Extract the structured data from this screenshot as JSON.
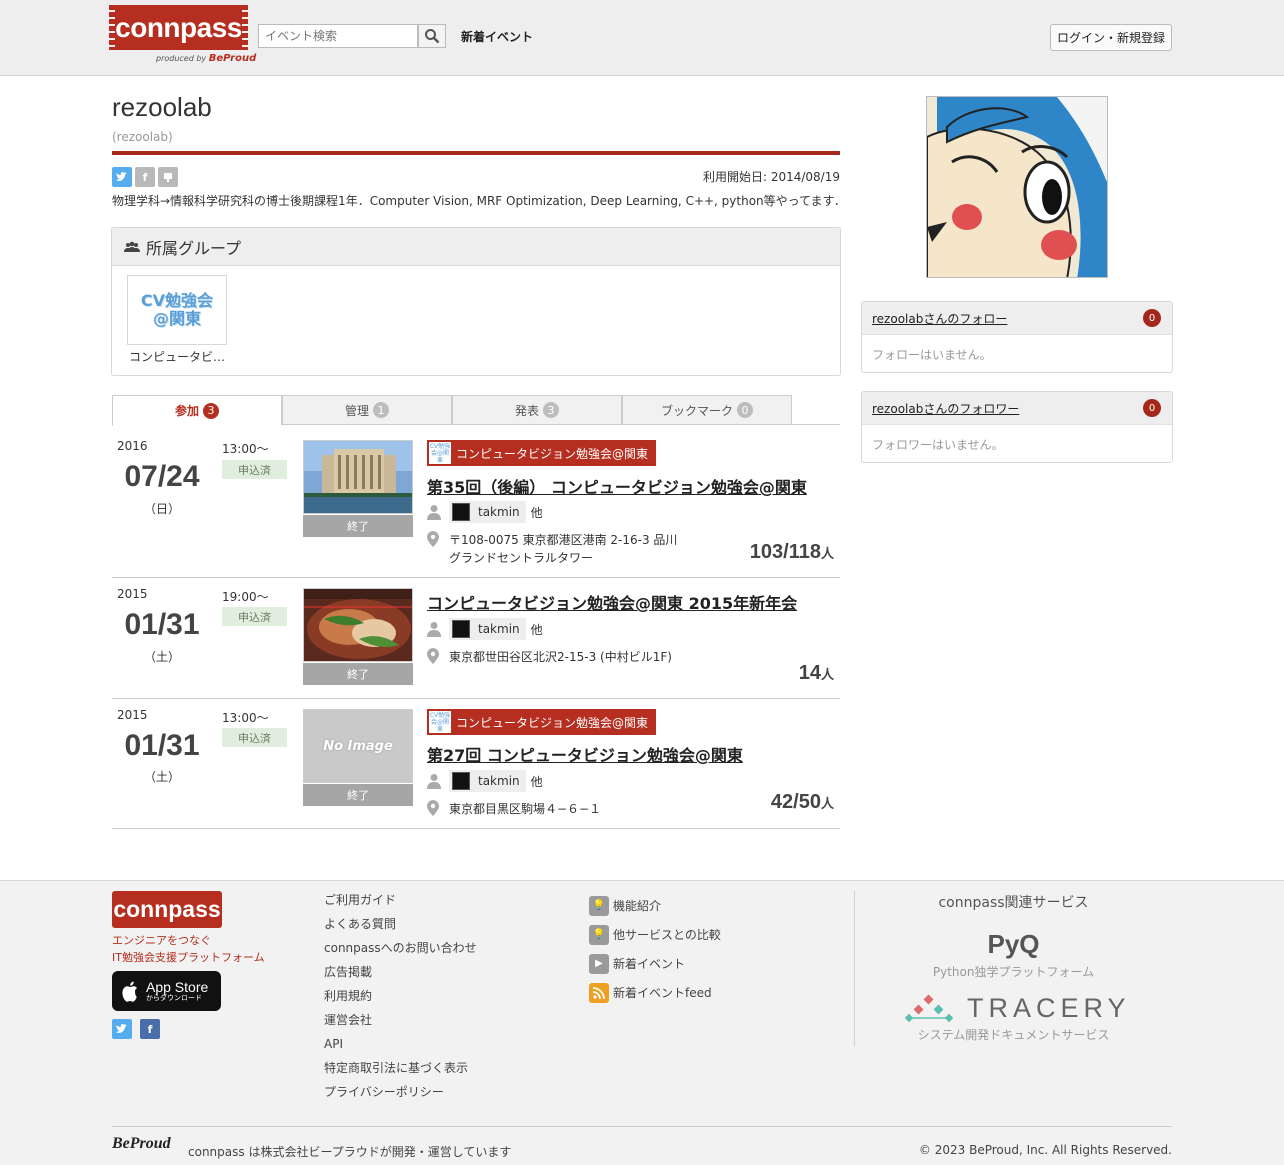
{
  "header": {
    "logo": "connpass",
    "logo_sub": "produced by",
    "logo_sub_brand": "BeProud",
    "search_placeholder": "イベント検索",
    "nav_new_events": "新着イベント",
    "login_label": "ログイン・新規登録"
  },
  "profile": {
    "display_name": "rezoolab",
    "username": "(rezoolab)",
    "since": "利用開始日: 2014/08/19",
    "bio": "物理学科→情報科学研究科の博士後期課程1年．Computer Vision, MRF Optimization, Deep Learning, C++, python等やってます．"
  },
  "groups": {
    "title": "所属グループ",
    "items": [
      {
        "thumb_text": "CV勉強会\n@関東",
        "name": "コンピュータビジョン勉強会@関東"
      }
    ]
  },
  "tabs": [
    {
      "label": "参加",
      "count": "3",
      "active": true
    },
    {
      "label": "管理",
      "count": "1",
      "active": false
    },
    {
      "label": "発表",
      "count": "3",
      "active": false
    },
    {
      "label": "ブックマーク",
      "count": "0",
      "active": false
    }
  ],
  "events": [
    {
      "year": "2016",
      "date": "07/24",
      "dow": "（日）",
      "time": "13:00〜",
      "status": "申込済",
      "ended": "終了",
      "group": "コンピュータビジョン勉強会@関東",
      "title": "第35回（後編） コンピュータビジョン勉強会@関東",
      "owner": "takmin",
      "owner_suffix": "他",
      "place": "〒108-0075 東京都港区港南 2-16-3 品川グランドセントラルタワー",
      "count": "103/118",
      "unit": "人"
    },
    {
      "year": "2015",
      "date": "01/31",
      "dow": "（土）",
      "time": "19:00〜",
      "status": "申込済",
      "ended": "終了",
      "group": "",
      "title": "コンピュータビジョン勉強会@関東 2015年新年会",
      "owner": "takmin",
      "owner_suffix": "他",
      "place": "東京都世田谷区北沢2-15-3 (中村ビル1F)",
      "count": "14",
      "unit": "人"
    },
    {
      "year": "2015",
      "date": "01/31",
      "dow": "（土）",
      "time": "13:00〜",
      "status": "申込済",
      "ended": "終了",
      "group": "コンピュータビジョン勉強会@関東",
      "title": "第27回 コンピュータビジョン勉強会@関東",
      "owner": "takmin",
      "owner_suffix": "他",
      "place": "東京都目黒区駒場４−６−１",
      "count": "42/50",
      "unit": "人",
      "no_image": "No Image"
    }
  ],
  "follow": {
    "following_title": "rezoolabさんのフォロー",
    "following_count": "0",
    "following_empty": "フォローはいません。",
    "followers_title": "rezoolabさんのフォロワー",
    "followers_count": "0",
    "followers_empty": "フォロワーはいません。"
  },
  "footer": {
    "logo": "connpass",
    "tagline1": "エンジニアをつなぐ",
    "tagline2": "IT勉強会支援プラットフォーム",
    "appstore_small": "からダウンロード",
    "appstore_big": "App Store",
    "links": [
      "ご利用ガイド",
      "よくある質問",
      "connpassへのお問い合わせ",
      "広告掲載",
      "利用規約",
      "運営会社",
      "API",
      "特定商取引法に基づく表示",
      "プライバシーポリシー"
    ],
    "features": [
      "機能紹介",
      "他サービスとの比較",
      "新着イベント",
      "新着イベントfeed"
    ],
    "related_title": "connpass関連サービス",
    "pyq_logo": "PyQ",
    "pyq_sub": "Python独学プラットフォーム",
    "tracery_logo": "TRACERY",
    "tracery_sub": "システム開発ドキュメントサービス",
    "beproud_logo": "BeProud",
    "credit": "connpass は株式会社ビープラウドが開発・運営しています",
    "copyright": "© 2023 BeProud, Inc. All Rights Reserved."
  },
  "colors": {
    "brand_red": "#b52e1f",
    "rule_red": "#a3271a",
    "status_green": "#dfeedd"
  }
}
